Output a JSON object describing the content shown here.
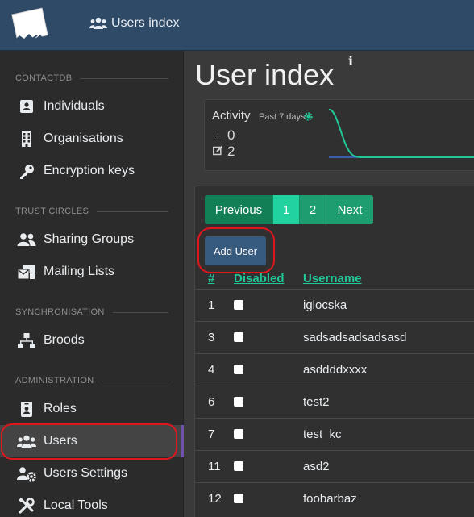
{
  "header": {
    "nav_label": "Users index",
    "nav_icon": "users-icon"
  },
  "sidebar": {
    "sections": [
      {
        "title": "CONTACTDB"
      },
      {
        "title": "TRUST CIRCLES"
      },
      {
        "title": "SYNCHRONISATION"
      },
      {
        "title": "ADMINISTRATION"
      }
    ],
    "items": [
      {
        "label": "Individuals",
        "icon": "id-card-icon"
      },
      {
        "label": "Organisations",
        "icon": "building-icon"
      },
      {
        "label": "Encryption keys",
        "icon": "key-icon"
      },
      {
        "label": "Sharing Groups",
        "icon": "users-icon"
      },
      {
        "label": "Mailing Lists",
        "icon": "mail-bulk-icon"
      },
      {
        "label": "Broods",
        "icon": "network-icon"
      },
      {
        "label": "Roles",
        "icon": "id-badge-icon"
      },
      {
        "label": "Users",
        "icon": "users-icon",
        "active": true
      },
      {
        "label": "Users Settings",
        "icon": "users-cog-icon"
      },
      {
        "label": "Local Tools",
        "icon": "tools-icon"
      }
    ]
  },
  "main": {
    "title": "User index",
    "info_icon": "i",
    "activity": {
      "label": "Activity",
      "period": "Past 7 days",
      "added_symbol": "+",
      "added_count": "0",
      "edited_count": "2",
      "colors": {
        "line": "#1fc896",
        "baseline": "#3f6fd1"
      }
    },
    "pagination": {
      "previous": "Previous",
      "pages": [
        "1",
        "2"
      ],
      "next": "Next",
      "active_page": "1"
    },
    "add_user_label": "Add User",
    "table": {
      "headers": {
        "id": "#",
        "disabled": "Disabled",
        "username": "Username"
      },
      "rows": [
        {
          "id": "1",
          "username": "iglocska"
        },
        {
          "id": "3",
          "username": "sadsadsadsadsasd"
        },
        {
          "id": "4",
          "username": "asddddxxxx"
        },
        {
          "id": "6",
          "username": "test2"
        },
        {
          "id": "7",
          "username": "test_kc"
        },
        {
          "id": "11",
          "username": "asd2"
        },
        {
          "id": "12",
          "username": "foobarbaz"
        }
      ]
    }
  },
  "colors": {
    "topbar": "#2f4a66",
    "accent": "#1fc896",
    "active_marker": "#6f52ab",
    "annotation_red": "#e0161e",
    "button_primary": "#375a7f"
  }
}
